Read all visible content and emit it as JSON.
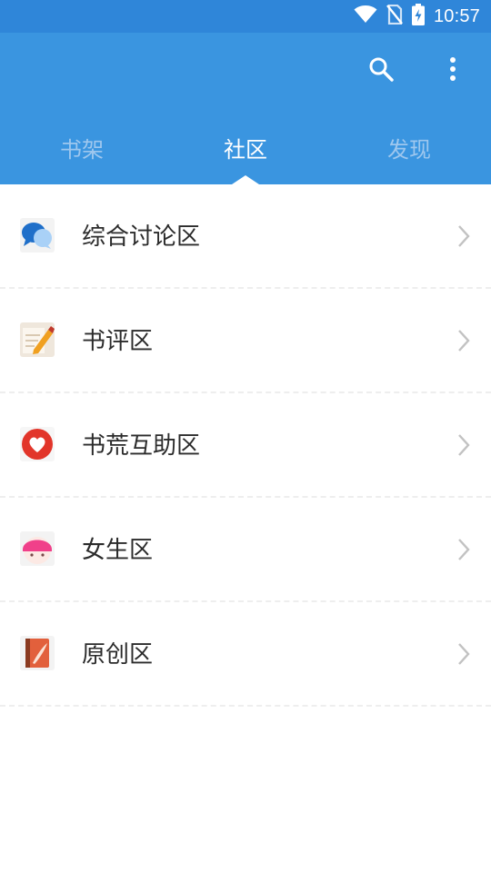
{
  "status_bar": {
    "time": "10:57",
    "icons": [
      "wifi-icon",
      "no-sim-icon",
      "battery-charging-icon"
    ]
  },
  "toolbar": {
    "icons": [
      "search-icon",
      "more-vertical-icon"
    ]
  },
  "tabs": [
    {
      "label": "书架",
      "active": false
    },
    {
      "label": "社区",
      "active": true
    },
    {
      "label": "发现",
      "active": false
    }
  ],
  "community": {
    "items": [
      {
        "label": "综合讨论区",
        "icon": "chat-bubbles-icon"
      },
      {
        "label": "书评区",
        "icon": "note-pencil-icon"
      },
      {
        "label": "书荒互助区",
        "icon": "heart-icon"
      },
      {
        "label": "女生区",
        "icon": "girl-face-icon"
      },
      {
        "label": "原创区",
        "icon": "notebook-quill-icon"
      }
    ]
  },
  "colors": {
    "header": "#3a95e0",
    "status_bar": "#2f86d9",
    "tab_active": "#ffffff",
    "tab_inactive": "#9ec7ee"
  }
}
